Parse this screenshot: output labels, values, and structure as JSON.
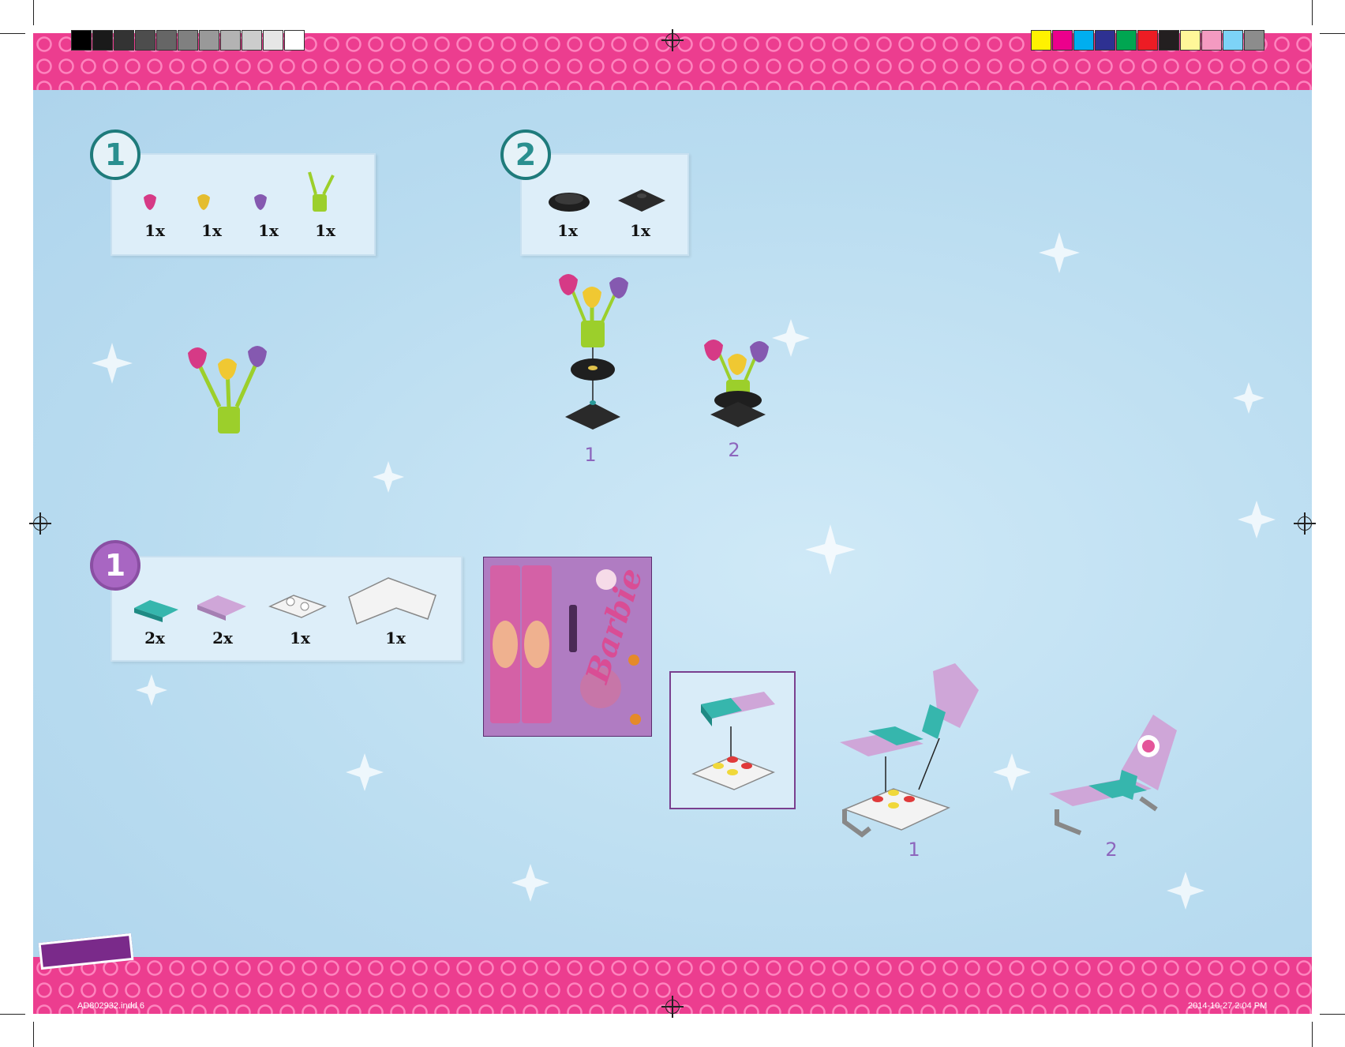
{
  "colors": {
    "band": "#ec3d8f",
    "sky": "#bcdff2",
    "accent_teal": "#1f7b7b",
    "accent_purple": "#8a4fa3",
    "step_number": "#8d66bd"
  },
  "grayscale_swatches": [
    "#000000",
    "#1a1a1a",
    "#333333",
    "#4d4d4d",
    "#666666",
    "#808080",
    "#999999",
    "#b3b3b3",
    "#cccccc",
    "#e6e6e6",
    "#ffffff"
  ],
  "color_swatches": [
    "#fff200",
    "#ec008c",
    "#00aeef",
    "#2e3192",
    "#00a651",
    "#ed1c24",
    "#231f20",
    "#fff799",
    "#f49ac1",
    "#7dd3f7",
    "#8c8c8c"
  ],
  "section1": {
    "step_a": {
      "number": "1",
      "parts": [
        {
          "qty": "1x",
          "icon": "pink-flower-icon"
        },
        {
          "qty": "1x",
          "icon": "yellow-flower-icon"
        },
        {
          "qty": "1x",
          "icon": "purple-flower-icon"
        },
        {
          "qty": "1x",
          "icon": "green-stem-icon"
        }
      ]
    },
    "step_b": {
      "number": "2",
      "parts": [
        {
          "qty": "1x",
          "icon": "black-dish-icon"
        },
        {
          "qty": "1x",
          "icon": "black-base-plate-icon"
        }
      ],
      "substeps": [
        "1",
        "2"
      ]
    }
  },
  "section2": {
    "step_a": {
      "number": "1",
      "parts": [
        {
          "qty": "2x",
          "icon": "teal-tile-icon"
        },
        {
          "qty": "2x",
          "icon": "lilac-tile-icon"
        },
        {
          "qty": "1x",
          "icon": "white-hinge-plate-icon"
        },
        {
          "qty": "1x",
          "icon": "white-lounger-frame-icon"
        }
      ],
      "substeps": [
        "1",
        "2"
      ]
    },
    "sticker_sheet": {
      "brand": "Barbie"
    }
  },
  "footer": {
    "file": "AD802932.indd   6",
    "timestamp": "2014-10-27   2:04 PM"
  }
}
